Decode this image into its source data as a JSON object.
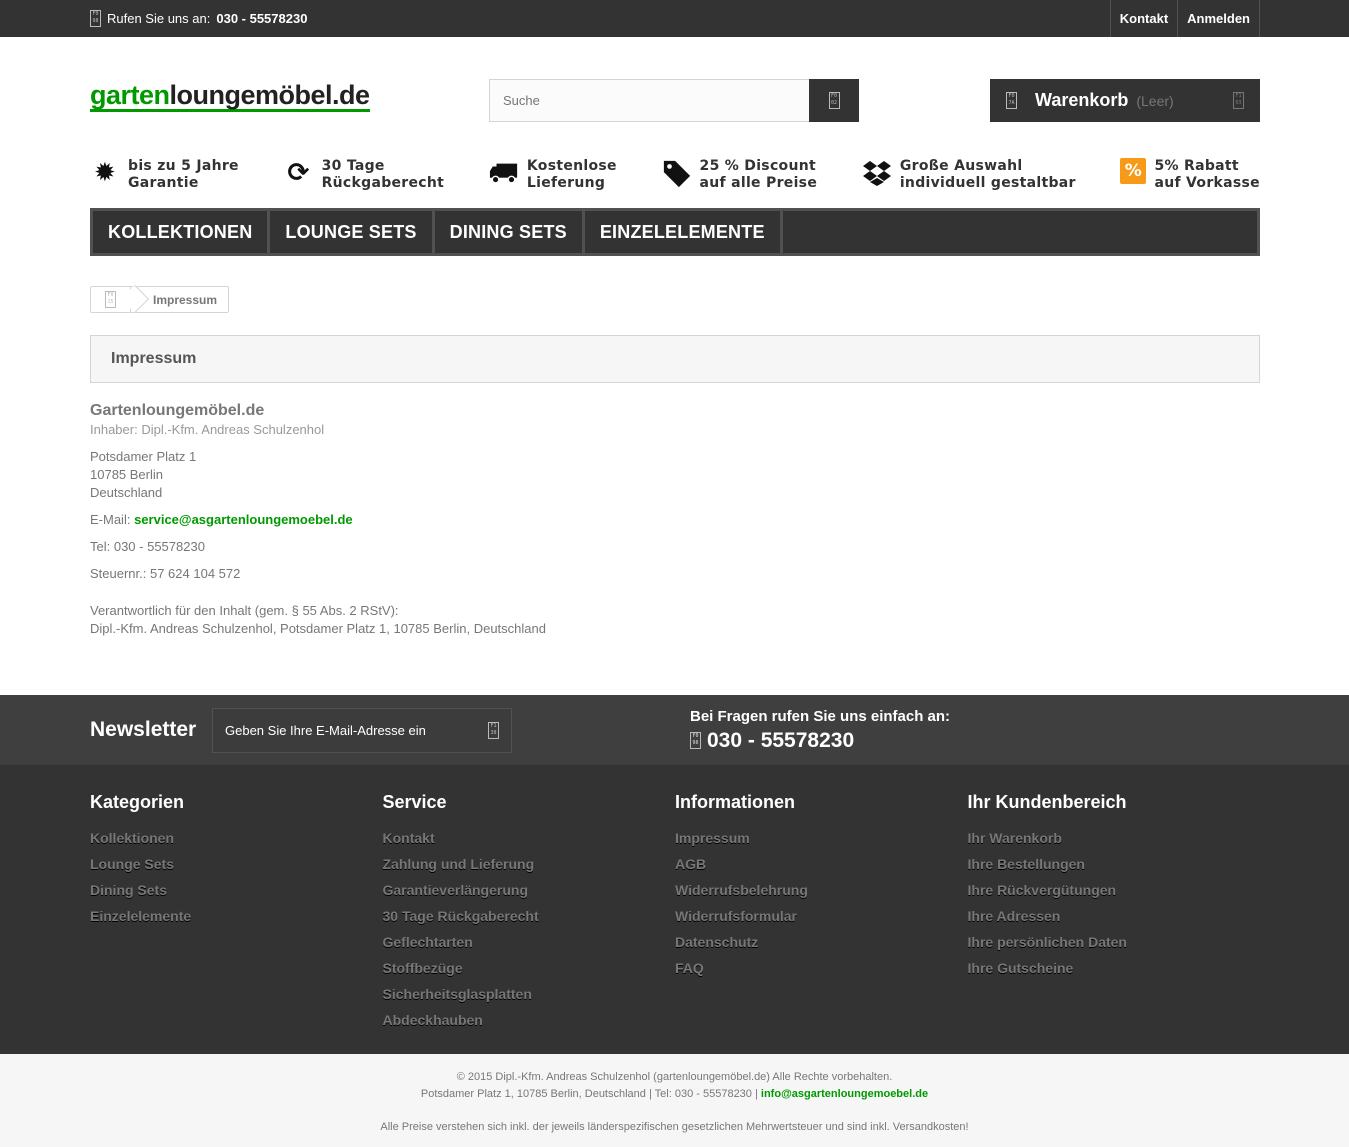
{
  "topbar": {
    "call_label": "Rufen Sie uns an:",
    "phone": "030 - 55578230",
    "links": [
      "Kontakt",
      "Anmelden"
    ]
  },
  "header": {
    "logo_green": "garten",
    "logo_dark": "loungemöbel.de",
    "search_placeholder": "Suche",
    "cart_title": "Warenkorb",
    "cart_status": "(Leer)"
  },
  "usps": [
    {
      "icon": "badge-icon",
      "line1": "bis zu 5 Jahre",
      "line2": "Garantie"
    },
    {
      "icon": "refresh-icon",
      "line1": "30 Tage",
      "line2": "Rückgaberecht"
    },
    {
      "icon": "truck-icon",
      "line1": "Kostenlose",
      "line2": "Lieferung"
    },
    {
      "icon": "tags-icon",
      "line1": "25 % Discount",
      "line2": "auf alle Preise"
    },
    {
      "icon": "dropbox-icon",
      "line1": "Große Auswahl",
      "line2": "individuell gestaltbar"
    },
    {
      "icon": "percent-icon",
      "line1": "5% Rabatt",
      "line2": "auf Vorkasse"
    }
  ],
  "menu": [
    "KOLLEKTIONEN",
    "LOUNGE SETS",
    "DINING SETS",
    "EINZELELEMENTE"
  ],
  "breadcrumb": {
    "current": "Impressum"
  },
  "page_heading": "Impressum",
  "impressum": {
    "company": "Gartenloungemöbel.de",
    "owner": "Inhaber: Dipl.-Kfm. Andreas Schulzenhol",
    "street": "Potsdamer Platz 1",
    "city": "10785 Berlin",
    "country": "Deutschland",
    "email_label": "E-Mail:",
    "email": "service@asgartenloungemoebel.de",
    "tel": "Tel: 030 - 55578230",
    "tax": "Steuernr.: 57 624 104 572",
    "resp_label": "Verantwortlich für den Inhalt (gem. § 55 Abs. 2 RStV):",
    "resp_value": "Dipl.-Kfm. Andreas Schulzenhol, Potsdamer Platz 1, 10785 Berlin, Deutschland"
  },
  "newsletter": {
    "title": "Newsletter",
    "placeholder": "Geben Sie Ihre E-Mail-Adresse ein",
    "question": "Bei Fragen rufen Sie uns einfach an:",
    "phone": "030 - 55578230"
  },
  "footer": {
    "columns": [
      {
        "title": "Kategorien",
        "items": [
          "Kollektionen",
          "Lounge Sets",
          "Dining Sets",
          "Einzelelemente"
        ]
      },
      {
        "title": "Service",
        "items": [
          "Kontakt",
          "Zahlung und Lieferung",
          "Garantieverlängerung",
          "30 Tage Rückgaberecht",
          "Geflechtarten",
          "Stoffbezüge",
          "Sicherheitsglasplatten",
          "Abdeckhauben"
        ]
      },
      {
        "title": "Informationen",
        "items": [
          "Impressum",
          "AGB",
          "Widerrufsbelehrung",
          "Widerrufsformular",
          "Datenschutz",
          "FAQ"
        ]
      },
      {
        "title": "Ihr Kundenbereich",
        "items": [
          "Ihr Warenkorb",
          "Ihre Bestellungen",
          "Ihre Rückvergütungen",
          "Ihre Adressen",
          "Ihre persönlichen Daten",
          "Ihre Gutscheine"
        ]
      }
    ]
  },
  "bottom": {
    "copyright": "© 2015 Dipl.-Kfm. Andreas Schulzenhol (gartenloungemöbel.de) Alle Rechte vorbehalten.",
    "address": "Potsdamer Platz 1, 10785 Berlin, Deutschland | Tel: 030 - 55578230 |",
    "email": "info@asgartenloungemoebel.de",
    "note": "Alle Preise verstehen sich inkl. der jeweils länderspezifischen gesetzlichen Mehrwertsteuer und sind inkl. Versandkosten!"
  }
}
